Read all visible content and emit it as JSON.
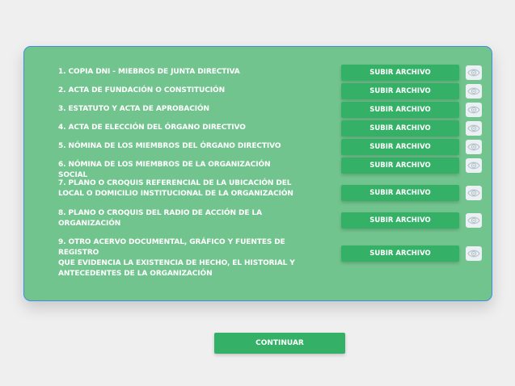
{
  "colors": {
    "card_background": "#72c48e",
    "card_border": "#3f8fe0",
    "button_green": "#35b167",
    "page_background": "#efefef"
  },
  "upload_label": "SUBIR ARCHIVO",
  "view_icon": "eye-icon",
  "documents": [
    {
      "label": "1. COPIA DNI - MIEBROS DE JUNTA DIRECTIVA"
    },
    {
      "label": "2. ACTA DE FUNDACIÓN O CONSTITUCIÓN"
    },
    {
      "label": "3. ESTATUTO Y ACTA DE APROBACIÓN"
    },
    {
      "label": "4. ACTA DE ELECCIÓN DEL ÓRGANO DIRECTIVO"
    },
    {
      "label": "5. NÓMINA DE LOS MIEMBROS DEL ÓRGANO DIRECTIVO"
    },
    {
      "label": "6. NÓMINA DE LOS MIEMBROS DE LA ORGANIZACIÓN SOCIAL"
    },
    {
      "label": "7. PLANO O CROQUIS REFERENCIAL DE LA UBICACIÓN  DEL\nLOCAL O DOMICILIO INSTITUCIONAL DE LA ORGANIZACIÓN"
    },
    {
      "label": "8. PLANO O CROQUIS DEL RADIO DE ACCIÓN DE LA\nORGANIZACIÓN"
    },
    {
      "label": "9. OTRO ACERVO DOCUMENTAL, GRÁFICO Y FUENTES DE REGISTRO\nQUE EVIDENCIA LA EXISTENCIA DE HECHO, EL HISTORIAL Y\nANTECEDENTES DE LA ORGANIZACIÓN"
    }
  ],
  "continue_label": "CONTINUAR"
}
